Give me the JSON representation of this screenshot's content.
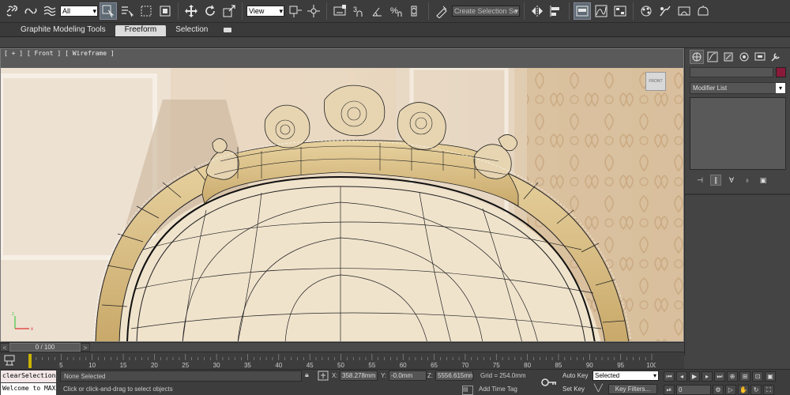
{
  "toolbar": {
    "selection_filter": "All",
    "ref_coord_system": "View",
    "named_selection_set": "Create Selection Se",
    "icons": [
      "link-icon",
      "unlink-icon",
      "bind-spacewarp-icon",
      "select-object-icon",
      "select-by-name-icon",
      "rect-region-icon",
      "window-crossing-icon",
      "move-icon",
      "rotate-icon",
      "scale-icon",
      "use-pivot-icon",
      "select-manipulate-icon",
      "keyboard-shortcut-icon",
      "snaps-3-icon",
      "angle-snap-icon",
      "percent-snap-icon",
      "spinner-snap-icon",
      "edit-named-sets-icon",
      "mirror-icon",
      "align-icon",
      "layer-manager-icon",
      "graphite-toggle-icon",
      "curve-editor-icon",
      "schematic-view-icon",
      "material-editor-icon",
      "render-setup-icon",
      "rendered-frame-icon",
      "render-production-icon"
    ]
  },
  "ribbon": {
    "tabs": [
      "Graphite Modeling Tools",
      "Freeform",
      "Selection"
    ],
    "active_tab": "Freeform"
  },
  "viewport": {
    "label": "[ + ] [ Front ] [ Wireframe ]",
    "viewcube_label": "FRONT"
  },
  "command_panel": {
    "modifier_list": "Modifier List",
    "object_color": "#8b1a3a"
  },
  "time_slider": {
    "position_label": "0 / 100",
    "ticks": [
      "0",
      "5",
      "10",
      "15",
      "20",
      "25",
      "30",
      "35",
      "40",
      "45",
      "50",
      "55",
      "60",
      "65",
      "70",
      "75",
      "80",
      "85",
      "90",
      "95",
      "100"
    ]
  },
  "listener": {
    "line1": "clearSelection",
    "line2": "Welcome to MAX!"
  },
  "status": {
    "selection_info": "None Selected",
    "prompt": "Click or click-and-drag to select objects",
    "x_label": "X:",
    "x_value": "358.278mm",
    "y_label": "Y:",
    "y_value": "-0.0mm",
    "z_label": "Z:",
    "z_value": "5556.615mm",
    "grid": "Grid = 254.0mm",
    "add_time_tag": "Add Time Tag",
    "auto_key": "Auto Key",
    "set_key": "Set Key",
    "key_mode_selected": "Selected",
    "key_filters": "Key Filters...",
    "current_frame": "0"
  }
}
